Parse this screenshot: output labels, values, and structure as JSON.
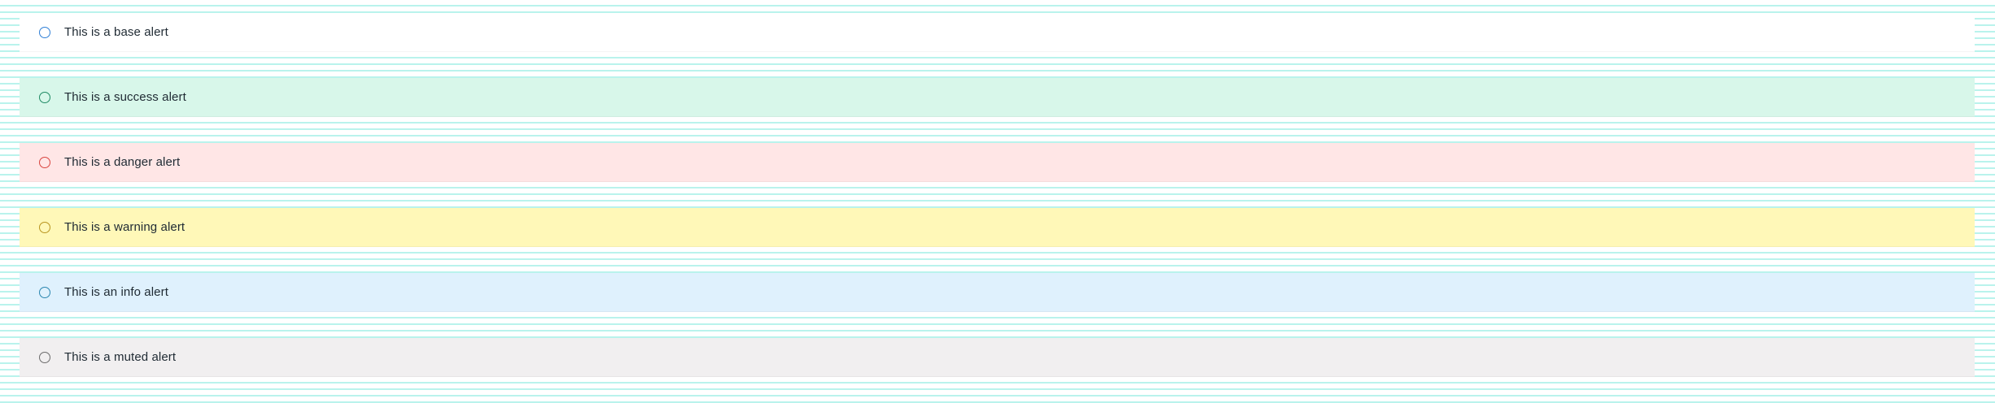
{
  "alerts": [
    {
      "variant": "base",
      "text": "This is a base alert",
      "background": "#ffffff",
      "icon_color": "#2f7fd6",
      "icon": "circle-icon"
    },
    {
      "variant": "success",
      "text": "This is a success alert",
      "background": "#d8f7ea",
      "icon_color": "#1f8a63",
      "icon": "circle-icon"
    },
    {
      "variant": "danger",
      "text": "This is a danger alert",
      "background": "#ffe6e6",
      "icon_color": "#d9443f",
      "icon": "circle-icon"
    },
    {
      "variant": "warning",
      "text": "This is a warning alert",
      "background": "#fff8b8",
      "icon_color": "#b8941f",
      "icon": "circle-icon"
    },
    {
      "variant": "info",
      "text": "This is an info alert",
      "background": "#dff1fd",
      "icon_color": "#2a86b0",
      "icon": "circle-icon"
    },
    {
      "variant": "muted",
      "text": "This is a muted alert",
      "background": "#f1eff0",
      "icon_color": "#6b6b6b",
      "icon": "circle-icon"
    }
  ]
}
